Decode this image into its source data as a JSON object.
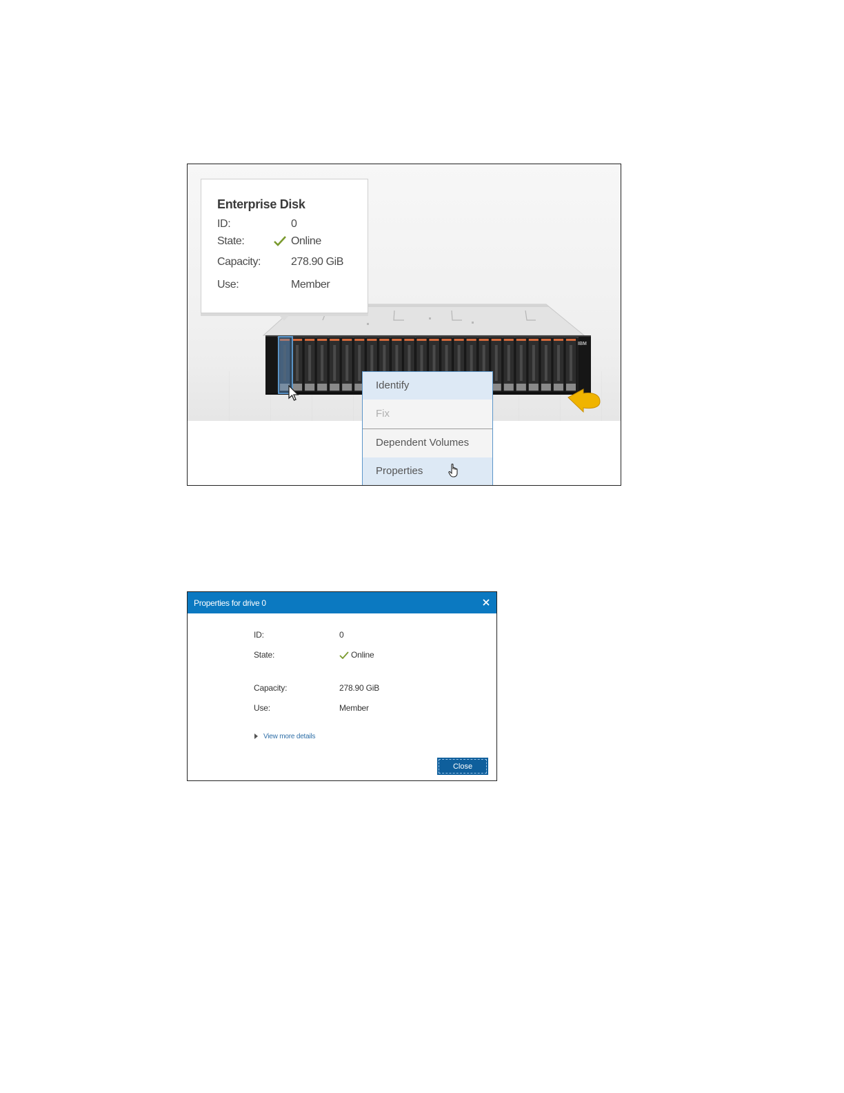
{
  "figure1": {
    "tooltip": {
      "title": "Enterprise Disk",
      "id_label": "ID:",
      "id_value": "0",
      "state_label": "State:",
      "state_value": "Online",
      "capacity_label": "Capacity:",
      "capacity_value": "278.90 GiB",
      "use_label": "Use:",
      "use_value": "Member"
    },
    "context_menu": {
      "items": [
        {
          "label": "Identify",
          "highlighted": true,
          "disabled": false
        },
        {
          "label": "Fix",
          "highlighted": false,
          "disabled": true
        },
        {
          "label": "Dependent Volumes",
          "highlighted": false,
          "disabled": false
        },
        {
          "label": "Properties",
          "highlighted": true,
          "disabled": false
        }
      ]
    },
    "enclosure": {
      "brand_text": "IBM",
      "drive_slot_count": 24,
      "selected_slot": 0,
      "arrow_icon": "rotate-arrow-icon"
    },
    "colors": {
      "check": "#7a9a2e",
      "selection": "#5b95c9",
      "menu_highlight": "#dde9f5",
      "slot_indicator": "#d2683a",
      "arrow": "#f0b400"
    }
  },
  "figure2": {
    "dialog": {
      "title": "Properties for drive 0",
      "id_label": "ID:",
      "id_value": "0",
      "state_label": "State:",
      "state_value": "Online",
      "capacity_label": "Capacity:",
      "capacity_value": "278.90 GiB",
      "use_label": "Use:",
      "use_value": "Member",
      "more_link": "View more details",
      "close_button": "Close"
    },
    "colors": {
      "header": "#0b79c1",
      "button": "#0f5f9c",
      "link": "#2f6fa7"
    }
  }
}
